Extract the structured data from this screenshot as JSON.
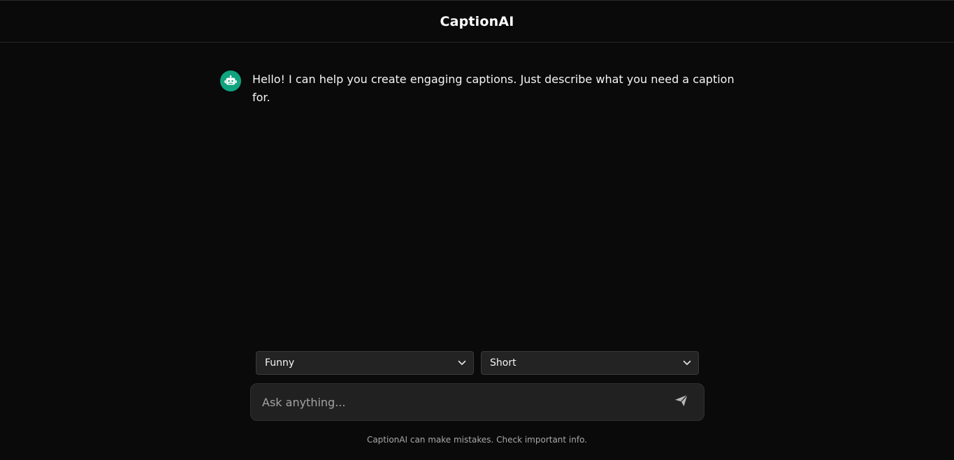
{
  "header": {
    "title": "CaptionAI"
  },
  "chat": {
    "messages": [
      {
        "role": "assistant",
        "avatar_icon": "robot-icon",
        "text": "Hello! I can help you create engaging captions. Just describe what you need a caption for."
      }
    ]
  },
  "controls": {
    "tone": {
      "selected": "Funny"
    },
    "length": {
      "selected": "Short"
    }
  },
  "composer": {
    "placeholder": "Ask anything...",
    "value": "",
    "send_icon": "send-icon"
  },
  "footer": {
    "disclaimer": "CaptionAI can make mistakes. Check important info."
  },
  "colors": {
    "background": "#0a0a0a",
    "avatar": "#10a37f",
    "input_bg": "#212121",
    "select_bg": "#232323"
  }
}
